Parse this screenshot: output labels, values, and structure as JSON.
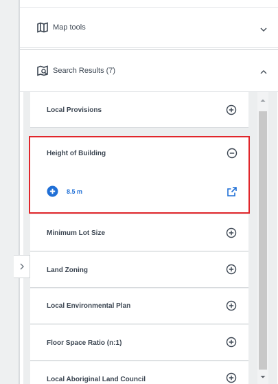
{
  "map_tools": {
    "title": "Map tools",
    "icon": "map-icon"
  },
  "search_results": {
    "title": "Search Results (7)",
    "icon": "search-results-icon"
  },
  "expanded_item": {
    "label": "Height of Building",
    "value": "8.5 m"
  },
  "items": [
    {
      "label": "Local Provisions"
    },
    {
      "label": "Minimum Lot Size"
    },
    {
      "label": "Land Zoning"
    },
    {
      "label": "Local Environmental Plan"
    },
    {
      "label": "Floor Space Ratio (n:1)"
    },
    {
      "label": "Local Aboriginal Land Council"
    }
  ],
  "colors": {
    "highlight": "#e0262b",
    "accent": "#1f6fd6",
    "text": "#3c4652"
  }
}
